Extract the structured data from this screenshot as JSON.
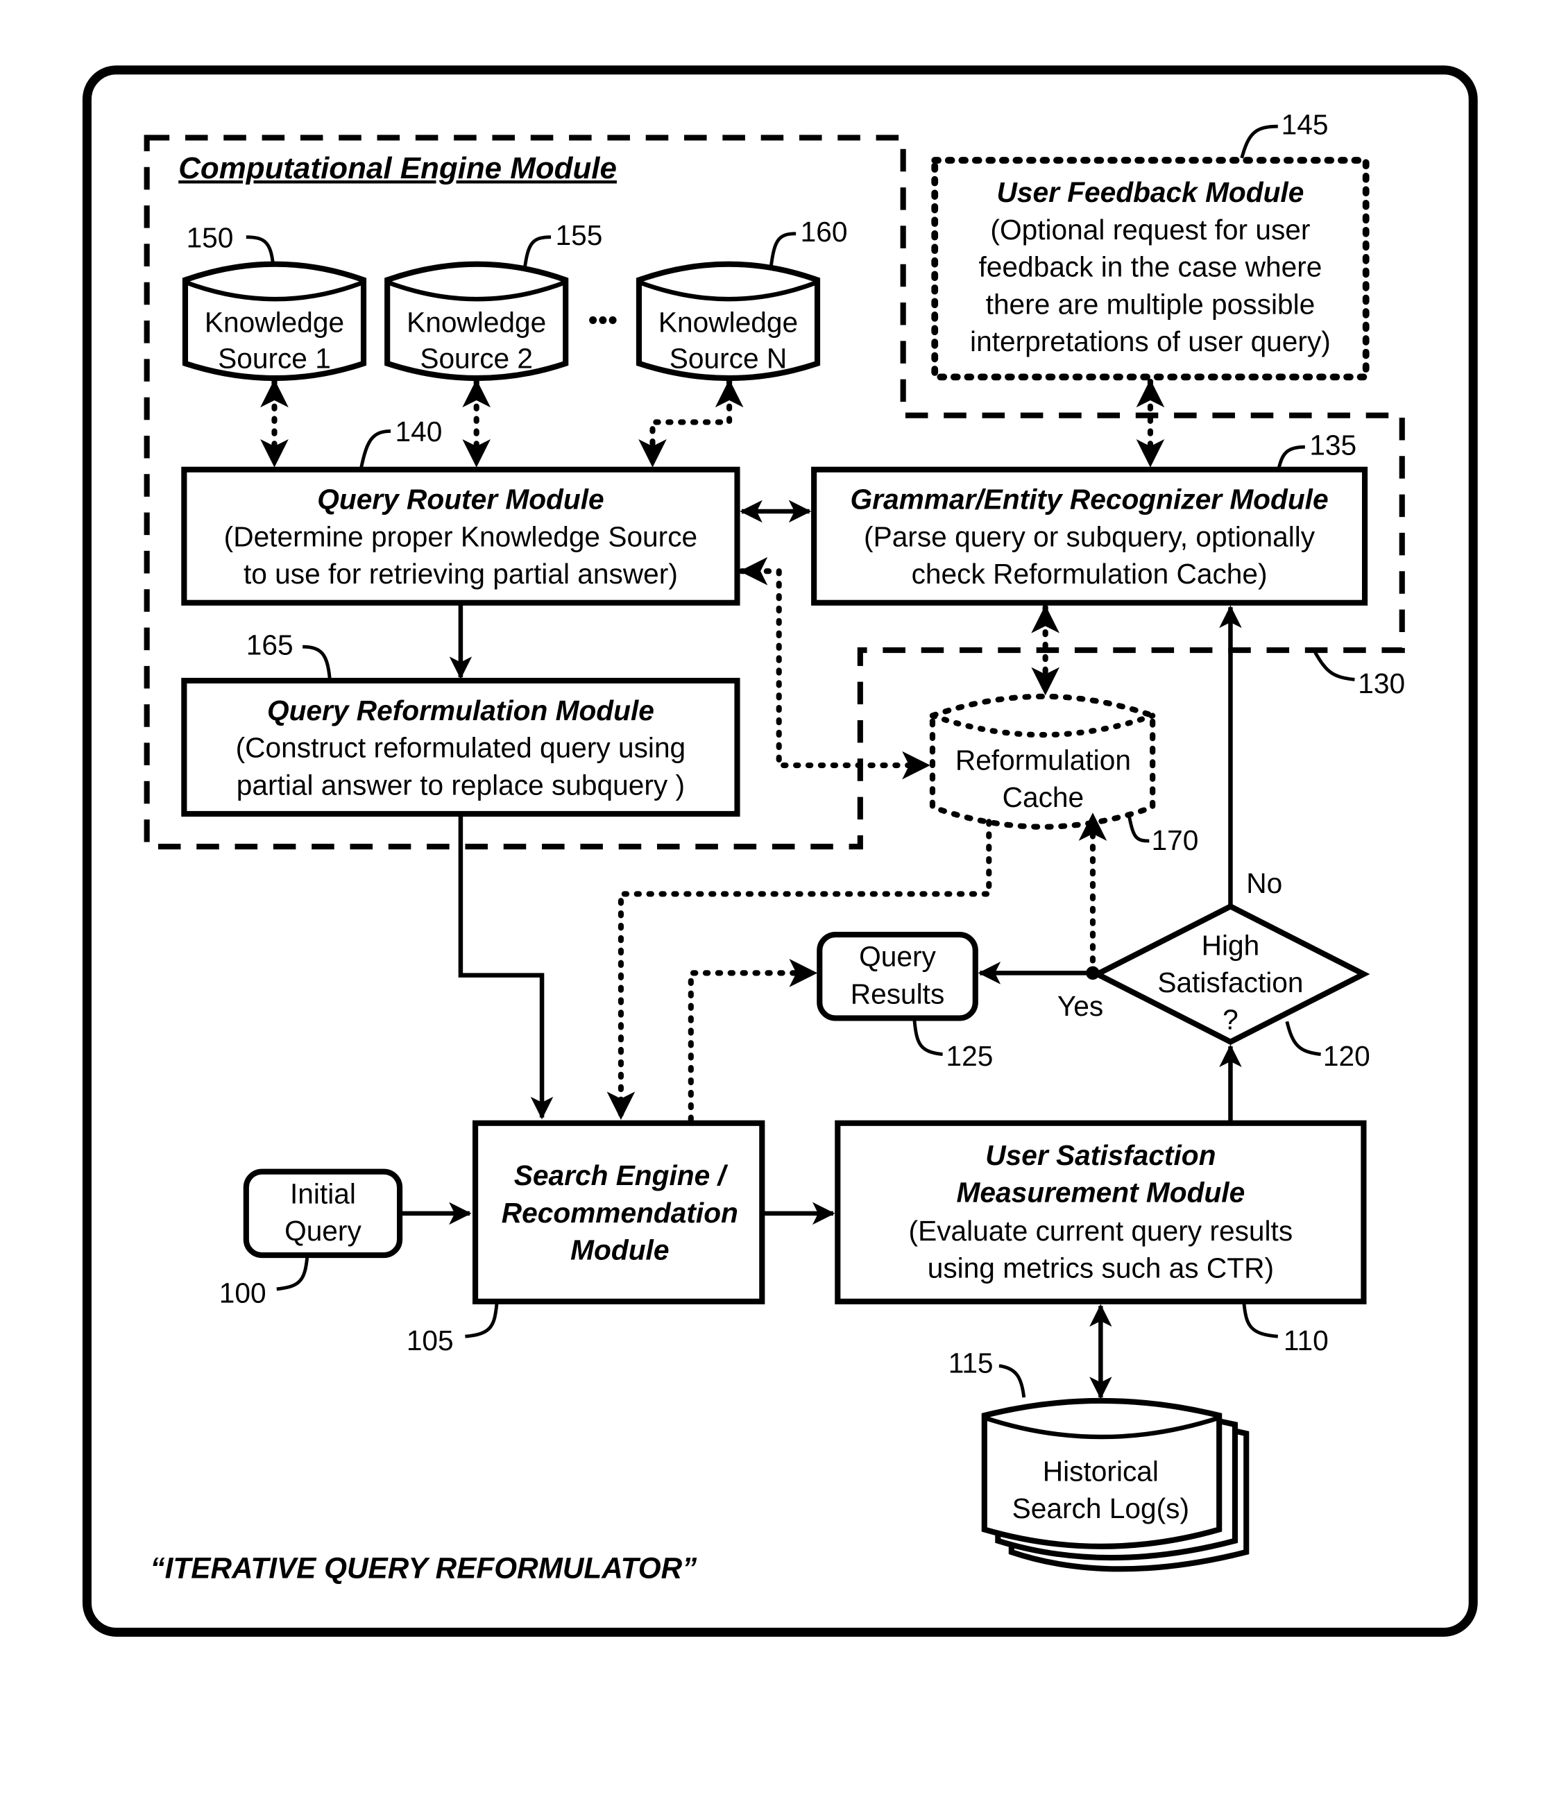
{
  "diagram": {
    "caption": "“ITERATIVE QUERY REFORMULATOR”",
    "groups": {
      "computational_engine": {
        "title": "Computational Engine Module",
        "ref": "130"
      }
    },
    "knowledge_sources": [
      {
        "line1": "Knowledge",
        "line2": "Source 1",
        "ref": "150"
      },
      {
        "line1": "Knowledge",
        "line2": "Source 2",
        "ref": "155"
      },
      {
        "line1": "Knowledge",
        "line2": "Source N",
        "ref": "160"
      }
    ],
    "ellipsis": "•••",
    "user_feedback": {
      "title": "User Feedback Module",
      "lines": [
        "(Optional request for user",
        "feedback in the case where",
        "there are multiple possible",
        "interpretations of user query)"
      ],
      "ref": "145"
    },
    "query_router": {
      "title": "Query Router Module",
      "lines": [
        "(Determine proper Knowledge Source",
        "to  use for retrieving partial answer)"
      ],
      "ref": "140"
    },
    "grammar_recognizer": {
      "title": "Grammar/Entity Recognizer Module",
      "lines": [
        "(Parse query or subquery, optionally",
        "check Reformulation Cache)"
      ],
      "ref": "135"
    },
    "query_reformulation": {
      "title": "Query Reformulation Module",
      "lines": [
        "(Construct reformulated query using",
        "partial answer to replace subquery )"
      ],
      "ref": "165"
    },
    "reformulation_cache": {
      "lines": [
        "Reformulation",
        "Cache"
      ],
      "ref": "170"
    },
    "query_results": {
      "lines": [
        "Query",
        "Results"
      ],
      "ref": "125"
    },
    "decision": {
      "lines": [
        "High",
        "Satisfaction",
        "?"
      ],
      "ref": "120",
      "yes_label": "Yes",
      "no_label": "No"
    },
    "initial_query": {
      "lines": [
        "Initial",
        "Query"
      ],
      "ref": "100"
    },
    "search_engine": {
      "lines": [
        "Search Engine /",
        "Recommendation",
        "Module"
      ],
      "ref": "105"
    },
    "user_satisfaction": {
      "title_lines": [
        "User Satisfaction",
        "Measurement Module"
      ],
      "lines": [
        "(Evaluate current query results",
        "using metrics such as CTR)"
      ],
      "ref": "110"
    },
    "search_logs": {
      "lines": [
        "Historical",
        "Search Log(s)"
      ],
      "ref": "115"
    }
  }
}
